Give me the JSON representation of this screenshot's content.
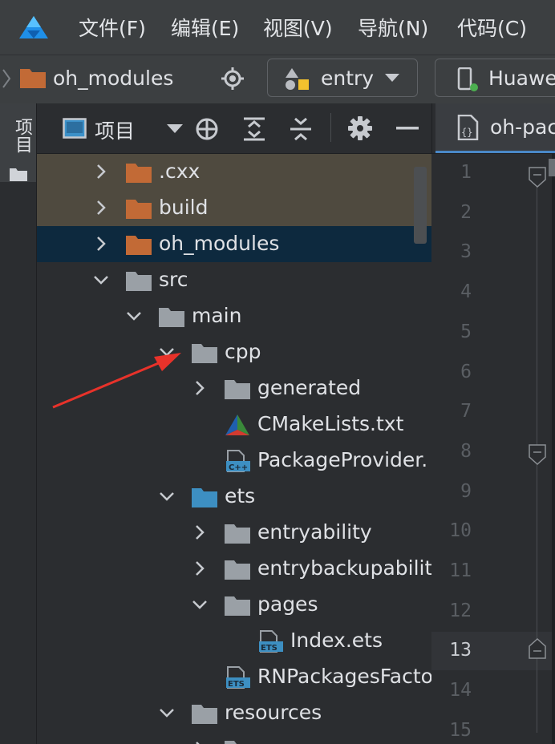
{
  "menubar": {
    "items": [
      "文件(F)",
      "编辑(E)",
      "视图(V)",
      "导航(N)",
      "代码(C)"
    ]
  },
  "navbar": {
    "breadcrumb": "oh_modules",
    "module_selector": "entry",
    "device_selector": "Huawei"
  },
  "toolstrip": {
    "project_tab": "项目"
  },
  "project_panel": {
    "title": "项目",
    "tree": [
      {
        "label": ".cxx",
        "icon": "folder-orange-icon",
        "arrow": "collapsed",
        "state": "excluded"
      },
      {
        "label": "build",
        "icon": "folder-orange-icon",
        "arrow": "collapsed",
        "state": "excluded"
      },
      {
        "label": "oh_modules",
        "icon": "folder-orange-icon",
        "arrow": "collapsed",
        "state": "selected"
      },
      {
        "label": "src",
        "icon": "folder-icon",
        "arrow": "expanded",
        "state": ""
      },
      {
        "label": "main",
        "icon": "folder-icon",
        "arrow": "expanded",
        "state": ""
      },
      {
        "label": "cpp",
        "icon": "folder-icon",
        "arrow": "expanded",
        "state": ""
      },
      {
        "label": "generated",
        "icon": "folder-icon",
        "arrow": "collapsed",
        "state": ""
      },
      {
        "label": "CMakeLists.txt",
        "icon": "cmake-icon",
        "arrow": "none",
        "state": ""
      },
      {
        "label": "PackageProvider.",
        "icon": "cpp-file-icon",
        "arrow": "none",
        "state": ""
      },
      {
        "label": "ets",
        "icon": "folder-blue-icon",
        "arrow": "expanded",
        "state": ""
      },
      {
        "label": "entryability",
        "icon": "folder-icon",
        "arrow": "collapsed",
        "state": ""
      },
      {
        "label": "entrybackupabilit",
        "icon": "folder-icon",
        "arrow": "collapsed",
        "state": ""
      },
      {
        "label": "pages",
        "icon": "folder-icon",
        "arrow": "expanded",
        "state": ""
      },
      {
        "label": "Index.ets",
        "icon": "ets-file-icon",
        "arrow": "none",
        "state": ""
      },
      {
        "label": "RNPackagesFacto",
        "icon": "ets-file-icon",
        "arrow": "none",
        "state": ""
      },
      {
        "label": "resources",
        "icon": "folder-icon",
        "arrow": "expanded",
        "state": ""
      },
      {
        "label": "",
        "icon": "folder-icon",
        "arrow": "collapsed",
        "state": ""
      }
    ]
  },
  "editor": {
    "tab_label": "oh-pac",
    "line_numbers": [
      "1",
      "2",
      "3",
      "4",
      "5",
      "6",
      "7",
      "8",
      "9",
      "10",
      "11",
      "12",
      "13",
      "14",
      "15"
    ],
    "current_line": "13"
  },
  "colors": {
    "accent": "#4a88c7",
    "folder_orange": "#c26a36",
    "folder_grey": "#9aa0a6",
    "folder_blue": "#3d8fc2",
    "selected_row": "#0d293e",
    "excluded_row": "#4f4a3f",
    "annotation_arrow": "#e8322a"
  }
}
